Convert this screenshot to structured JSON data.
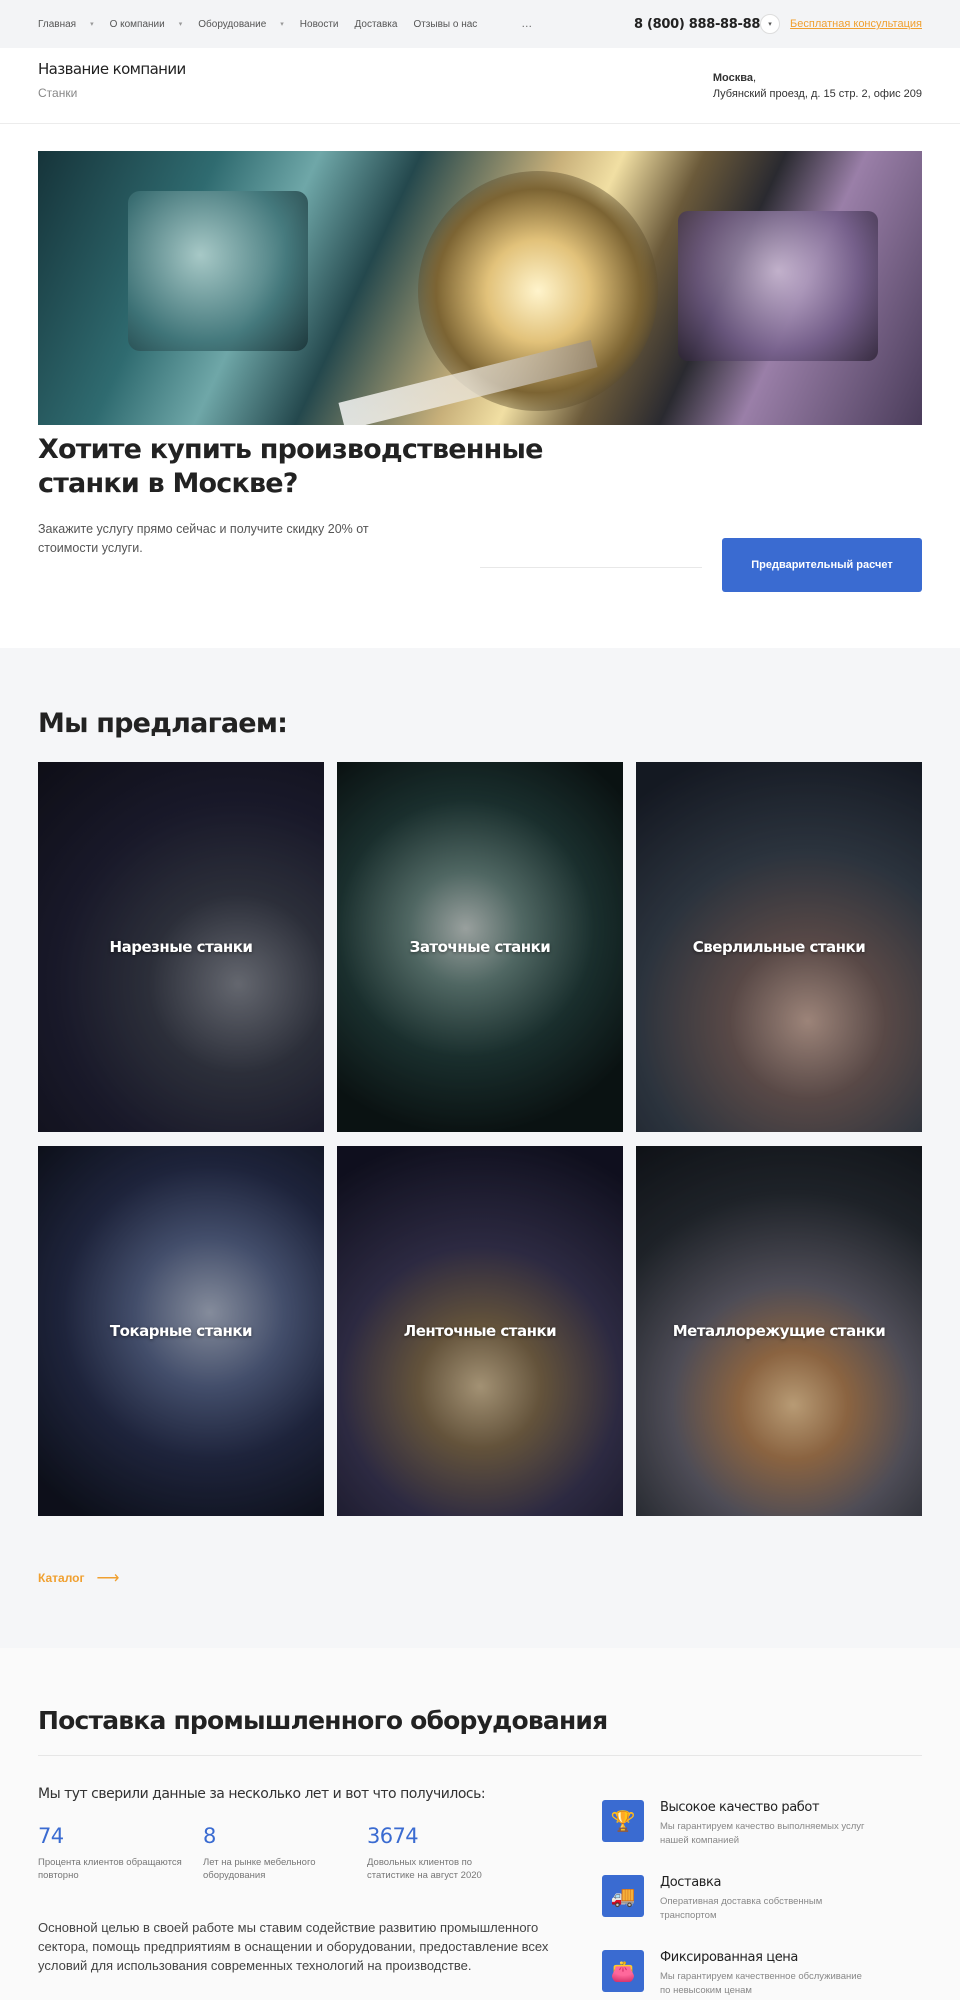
{
  "topbar": {
    "nav": [
      {
        "label": "Главная",
        "has_dropdown": true
      },
      {
        "label": "О компании",
        "has_dropdown": true
      },
      {
        "label": "Оборудование",
        "has_dropdown": true
      },
      {
        "label": "Новости",
        "has_dropdown": false
      },
      {
        "label": "Доставка",
        "has_dropdown": false
      },
      {
        "label": "Отзывы о нас",
        "has_dropdown": false
      }
    ],
    "more": "…",
    "phone": "8 (800) 888-88-88",
    "consult": "Бесплатная консультация"
  },
  "header": {
    "company_name": "Название компании",
    "company_sub": "Станки",
    "city": "Москва",
    "address": "Лубянский проезд, д. 15 стр. 2, офис 209"
  },
  "hero": {
    "title": "Хотите купить производственные станки в Москве?",
    "description": "Закажите услугу прямо сейчас и получите скидку 20% от стоимости услуги.",
    "button": "Предварительный расчет"
  },
  "offer": {
    "title": "Мы предлагаем:",
    "cards": [
      {
        "label": "Нарезные станки"
      },
      {
        "label": "Заточные станки"
      },
      {
        "label": "Сверлильные станки"
      },
      {
        "label": "Токарные станки"
      },
      {
        "label": "Ленточные станки"
      },
      {
        "label": "Металлорежущие станки"
      }
    ],
    "catalog": "Каталог"
  },
  "supply": {
    "title": "Поставка промышленного оборудования",
    "subtitle": "Мы тут сверили данные за несколько лет и вот что получилось:",
    "stats": [
      {
        "value": "74",
        "label": "Процента клиентов обращаются повторно"
      },
      {
        "value": "8",
        "label": "Лет на рынке мебельного оборудования"
      },
      {
        "value": "3674",
        "label": "Довольных клиентов по статистике на август 2020"
      }
    ],
    "text": "Основной целью в своей работе мы ставим содействие развитию промышленного сектора, помощь предприятиям в оснащении и оборудовании, предоставление всех условий для использования современных технологий на производстве.",
    "features": [
      {
        "icon": "trophy-icon",
        "title": "Высокое качество работ",
        "desc": "Мы гарантируем качество выполняемых услуг нашей компанией"
      },
      {
        "icon": "truck-icon",
        "title": "Доставка",
        "desc": "Оперативная доставка собственным транспортом"
      },
      {
        "icon": "wallet-icon",
        "title": "Фиксированная цена",
        "desc": "Мы гарантируем качественное обслуживание по невысоким ценам"
      }
    ]
  },
  "colors": {
    "accent": "#3a6bd1",
    "link": "#f0a030"
  }
}
